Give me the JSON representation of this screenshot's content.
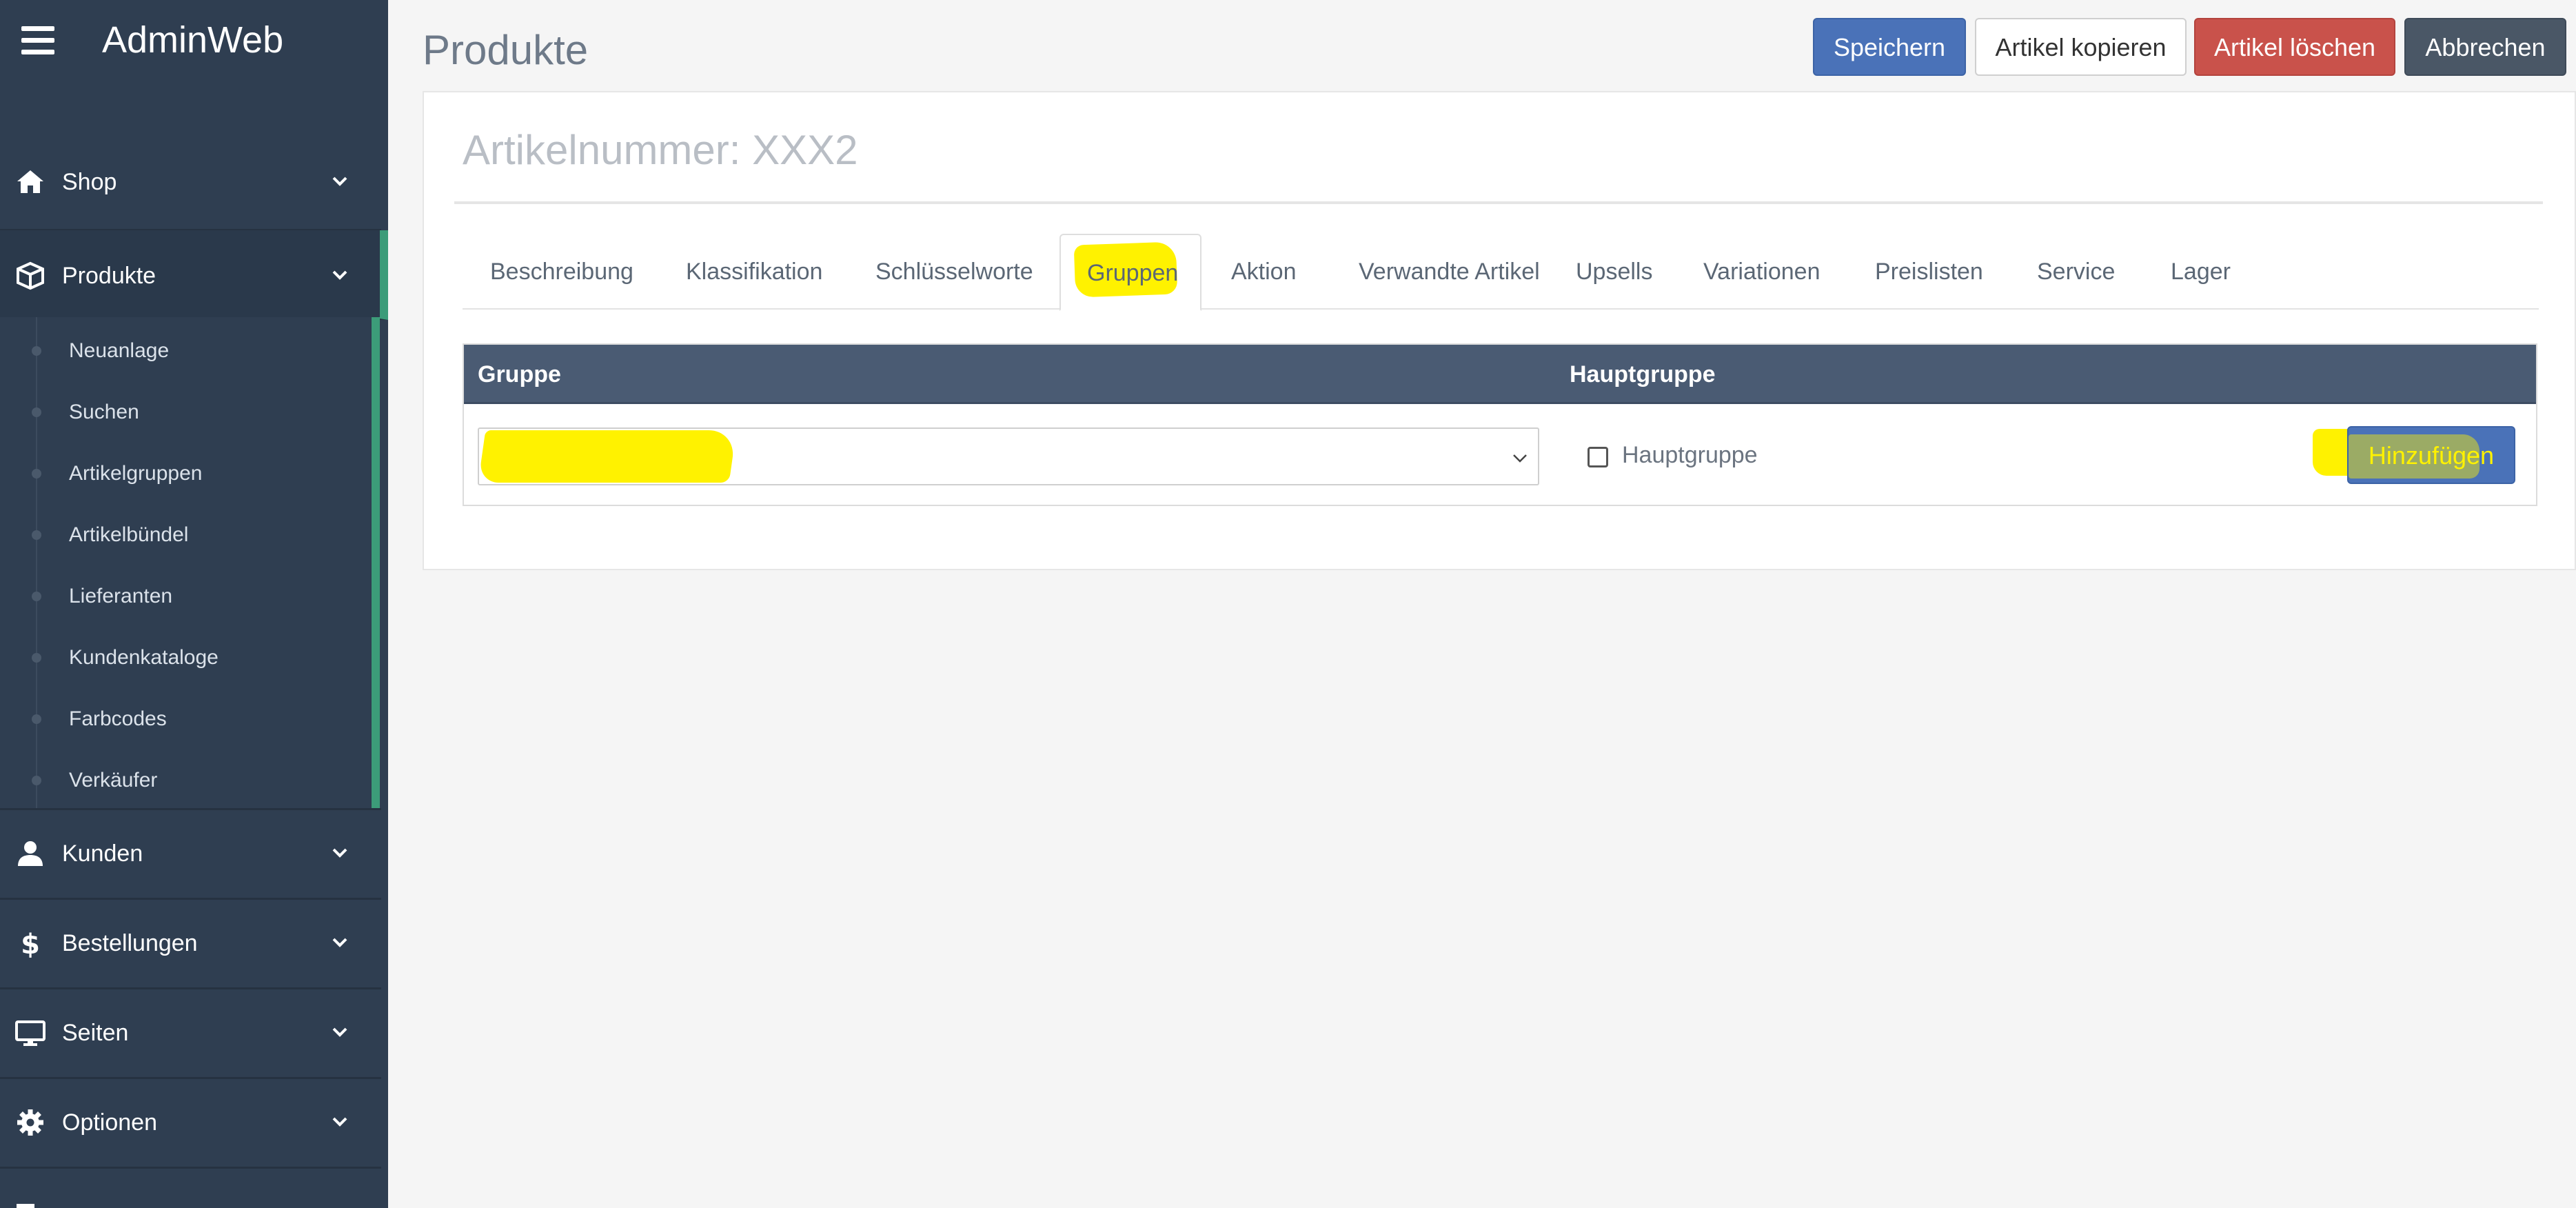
{
  "app": {
    "brand": "AdminWeb"
  },
  "sidebar": {
    "items": [
      {
        "label": "Shop",
        "icon": "home-icon"
      },
      {
        "label": "Produkte",
        "icon": "cube-icon",
        "active": true
      },
      {
        "label": "Kunden",
        "icon": "user-icon"
      },
      {
        "label": "Bestellungen",
        "icon": "dollar-icon"
      },
      {
        "label": "Seiten",
        "icon": "monitor-icon"
      },
      {
        "label": "Optionen",
        "icon": "gear-icon"
      }
    ],
    "submenu": [
      "Neuanlage",
      "Suchen",
      "Artikelgruppen",
      "Artikelbündel",
      "Lieferanten",
      "Kundenkataloge",
      "Farbcodes",
      "Verkäufer"
    ]
  },
  "header": {
    "title": "Produkte",
    "buttons": {
      "save": "Speichern",
      "copy": "Artikel kopieren",
      "delete": "Artikel löschen",
      "cancel": "Abbrechen"
    }
  },
  "article": {
    "title": "Artikelnummer: XXX2"
  },
  "tabs": [
    "Beschreibung",
    "Klassifikation",
    "Schlüsselworte",
    "Gruppen",
    "Aktion",
    "Verwandte Artikel",
    "Upsells",
    "Variationen",
    "Preislisten",
    "Service",
    "Lager"
  ],
  "active_tab": "Gruppen",
  "groups": {
    "col_group": "Gruppe",
    "col_main": "Hauptgruppe",
    "select_value": "",
    "checkbox_label": "Hauptgruppe",
    "add_button": "Hinzufügen"
  },
  "colors": {
    "sidebar_bg": "#2f3e51",
    "accent_green": "#3c9c79",
    "primary": "#4a72b8",
    "danger": "#c9524b",
    "dark": "#4a5766",
    "highlight": "#fff200"
  }
}
